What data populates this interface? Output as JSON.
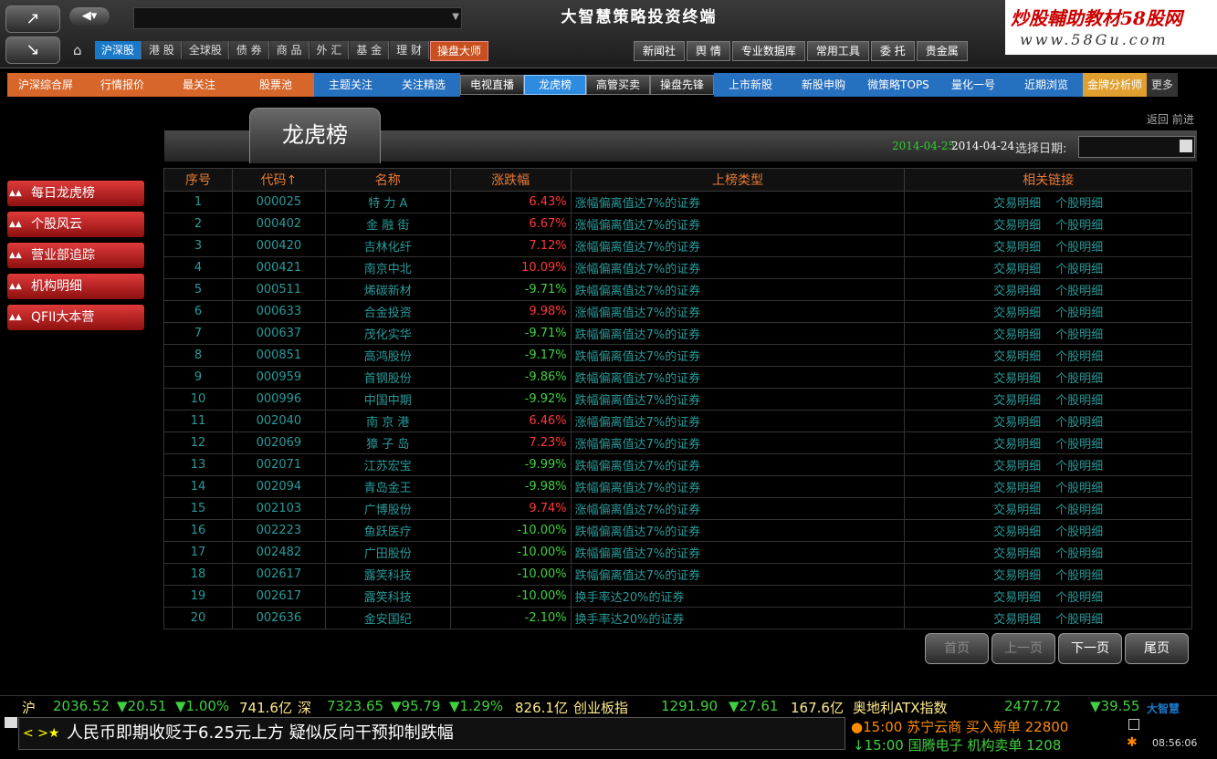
{
  "app": {
    "title": "大智慧策略投资终端",
    "watermark_line1": "炒股輔助教材58股网",
    "watermark_line2": "www.58Gu.com"
  },
  "toolbar": {
    "market_tabs": [
      "沪深股",
      "港 股",
      "全球股",
      "债 券",
      "商 品",
      "外 汇",
      "基 金",
      "理 财"
    ],
    "master_tab": "操盘大师",
    "tool_tabs": [
      "新闻社",
      "舆 情",
      "专业数据库",
      "常用工具",
      "委 托",
      "贵金属"
    ]
  },
  "nav2": [
    {
      "label": "沪深综合屏",
      "style": "orange",
      "w": 84
    },
    {
      "label": "行情报价",
      "style": "orange",
      "w": 84
    },
    {
      "label": "最关注",
      "style": "orange",
      "w": 84
    },
    {
      "label": "股票池",
      "style": "orange",
      "w": 84
    },
    {
      "label": "主题关注",
      "style": "blue",
      "w": 80
    },
    {
      "label": "关注精选",
      "style": "blue",
      "w": 80
    },
    {
      "label": "电视直播",
      "style": "dark",
      "w": 68
    },
    {
      "label": "龙虎榜",
      "style": "active",
      "w": 66
    },
    {
      "label": "高管买卖",
      "style": "dark",
      "w": 68
    },
    {
      "label": "操盘先锋",
      "style": "dark",
      "w": 68
    },
    {
      "label": "上市新股",
      "style": "blue",
      "w": 80
    },
    {
      "label": "新股申购",
      "style": "blue",
      "w": 80
    },
    {
      "label": "微策略TOPS",
      "style": "blue",
      "w": 84
    },
    {
      "label": "量化一号",
      "style": "blue",
      "w": 80
    },
    {
      "label": "近期浏览",
      "style": "blue",
      "w": 80
    },
    {
      "label": "金牌分析师",
      "style": "gold",
      "w": 70
    },
    {
      "label": "更多",
      "style": "more",
      "w": 34
    }
  ],
  "page": {
    "title": "龙虎榜",
    "back_forward": "返回 前进",
    "date_green": "2014-04-25",
    "date_white": "2014-04-24",
    "date_label": "选择日期:",
    "date_input": ""
  },
  "sidebar": [
    "每日龙虎榜",
    "个股风云",
    "营业部追踪",
    "机构明细",
    "QFII大本营"
  ],
  "table": {
    "headers": [
      "序号",
      "代码↑",
      "名称",
      "涨跌幅",
      "上榜类型",
      "相关链接"
    ],
    "link1": "交易明细",
    "link2": "个股明细",
    "rows": [
      {
        "idx": "1",
        "code": "000025",
        "name": "特 力 A",
        "chg": "6.43%",
        "dir": "up",
        "type": "涨幅偏离值达7%的证券"
      },
      {
        "idx": "2",
        "code": "000402",
        "name": "金 融 街",
        "chg": "6.67%",
        "dir": "up",
        "type": "涨幅偏离值达7%的证券"
      },
      {
        "idx": "3",
        "code": "000420",
        "name": "吉林化纤",
        "chg": "7.12%",
        "dir": "up",
        "type": "涨幅偏离值达7%的证券"
      },
      {
        "idx": "4",
        "code": "000421",
        "name": "南京中北",
        "chg": "10.09%",
        "dir": "up",
        "type": "涨幅偏离值达7%的证券"
      },
      {
        "idx": "5",
        "code": "000511",
        "name": "烯碳新材",
        "chg": "-9.71%",
        "dir": "down",
        "type": "跌幅偏离值达7%的证券"
      },
      {
        "idx": "6",
        "code": "000633",
        "name": "合金投资",
        "chg": "9.98%",
        "dir": "up",
        "type": "涨幅偏离值达7%的证券"
      },
      {
        "idx": "7",
        "code": "000637",
        "name": "茂化实华",
        "chg": "-9.71%",
        "dir": "down",
        "type": "跌幅偏离值达7%的证券"
      },
      {
        "idx": "8",
        "code": "000851",
        "name": "高鸿股份",
        "chg": "-9.17%",
        "dir": "down",
        "type": "跌幅偏离值达7%的证券"
      },
      {
        "idx": "9",
        "code": "000959",
        "name": "首钢股份",
        "chg": "-9.86%",
        "dir": "down",
        "type": "跌幅偏离值达7%的证券"
      },
      {
        "idx": "10",
        "code": "000996",
        "name": "中国中期",
        "chg": "-9.92%",
        "dir": "down",
        "type": "跌幅偏离值达7%的证券"
      },
      {
        "idx": "11",
        "code": "002040",
        "name": "南 京 港",
        "chg": "6.46%",
        "dir": "up",
        "type": "涨幅偏离值达7%的证券"
      },
      {
        "idx": "12",
        "code": "002069",
        "name": "獐 子 岛",
        "chg": "7.23%",
        "dir": "up",
        "type": "涨幅偏离值达7%的证券"
      },
      {
        "idx": "13",
        "code": "002071",
        "name": "江苏宏宝",
        "chg": "-9.99%",
        "dir": "down",
        "type": "跌幅偏离值达7%的证券"
      },
      {
        "idx": "14",
        "code": "002094",
        "name": "青岛金王",
        "chg": "-9.98%",
        "dir": "down",
        "type": "跌幅偏离值达7%的证券"
      },
      {
        "idx": "15",
        "code": "002103",
        "name": "广博股份",
        "chg": "9.74%",
        "dir": "up",
        "type": "涨幅偏离值达7%的证券"
      },
      {
        "idx": "16",
        "code": "002223",
        "name": "鱼跃医疗",
        "chg": "-10.00%",
        "dir": "down",
        "type": "跌幅偏离值达7%的证券"
      },
      {
        "idx": "17",
        "code": "002482",
        "name": "广田股份",
        "chg": "-10.00%",
        "dir": "down",
        "type": "跌幅偏离值达7%的证券"
      },
      {
        "idx": "18",
        "code": "002617",
        "name": "露笑科技",
        "chg": "-10.00%",
        "dir": "down",
        "type": "跌幅偏离值达7%的证券"
      },
      {
        "idx": "19",
        "code": "002617",
        "name": "露笑科技",
        "chg": "-10.00%",
        "dir": "down",
        "type": "换手率达20%的证券"
      },
      {
        "idx": "20",
        "code": "002636",
        "name": "金安国纪",
        "chg": "-2.10%",
        "dir": "down",
        "type": "换手率达20%的证券"
      }
    ]
  },
  "pager": [
    "首页",
    "上一页",
    "下一页",
    "尾页"
  ],
  "ticker": {
    "sh_label": "沪",
    "sh_val": "2036.52",
    "sh_chg": "▼20.51",
    "sh_pct": "▼1.00%",
    "sh_amt": "741.6亿",
    "sz_label": "深",
    "sz_val": "7323.65",
    "sz_chg": "▼95.79",
    "sz_pct": "▼1.29%",
    "sz_amt": "826.1亿",
    "cy_label": "创业板指",
    "cy_val": "1291.90",
    "cy_chg": "▼27.61",
    "cy_amt": "167.6亿",
    "at_label": "奥地利ATX指数",
    "at_val": "2477.72",
    "at_chg": "▼39.55"
  },
  "news": {
    "headline": "人民币即期收贬于6.25元上方 疑似反向干预抑制跌幅"
  },
  "alerts": {
    "a1": "●15:00 苏宁云商 买入新单 22800",
    "a2": "↓15:00 国腾电子 机构卖单 1208"
  },
  "status": {
    "brand": "大智慧",
    "clock": "08:56:06"
  }
}
